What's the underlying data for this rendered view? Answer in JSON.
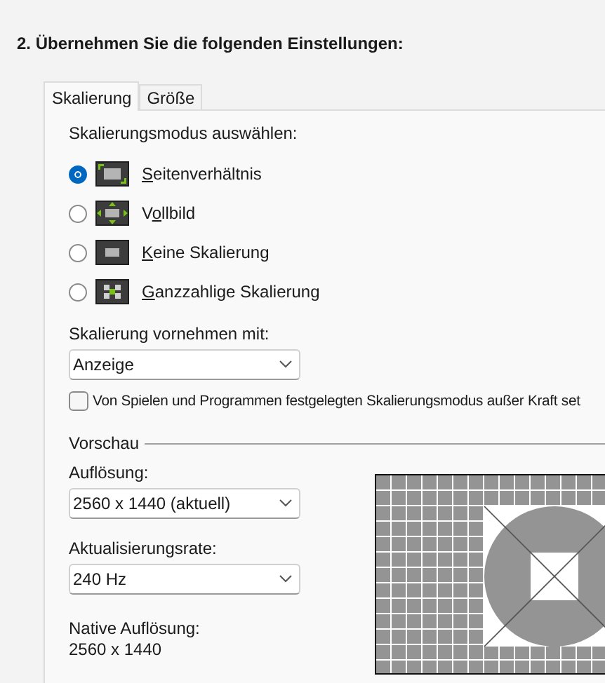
{
  "heading": "2. Übernehmen Sie die folgenden Einstellungen:",
  "tabs": [
    {
      "label": "Skalierung",
      "selected": true
    },
    {
      "label": "Größe",
      "selected": false
    }
  ],
  "scaling_mode": {
    "label": "Skalierungsmodus auswählen:",
    "options": [
      {
        "kind": "aspect",
        "label": {
          "key": "S",
          "after": "eitenverhältnis"
        },
        "selected": true
      },
      {
        "kind": "fullscreen",
        "label": {
          "before": "V",
          "key": "o",
          "after": "llbild"
        },
        "selected": false
      },
      {
        "kind": "none",
        "label": {
          "key": "K",
          "after": "eine Skalierung"
        },
        "selected": false
      },
      {
        "kind": "integer",
        "label": {
          "key": "G",
          "after": "anzzahlige Skalierung"
        },
        "selected": false
      }
    ]
  },
  "perform_scaling": {
    "label": "Skalierung vornehmen mit:",
    "value": "Anzeige"
  },
  "override": {
    "label": "Von Spielen und Programmen festgelegten Skalierungsmodus außer Kraft set",
    "checked": false
  },
  "preview": {
    "title": "Vorschau",
    "resolution": {
      "label": "Auflösung:",
      "value": "2560 x 1440 (aktuell)"
    },
    "refresh_rate": {
      "label": "Aktualisierungsrate:",
      "value": "240 Hz"
    },
    "native": {
      "label": "Native Auflösung:",
      "value": "2560 x 1440"
    }
  }
}
